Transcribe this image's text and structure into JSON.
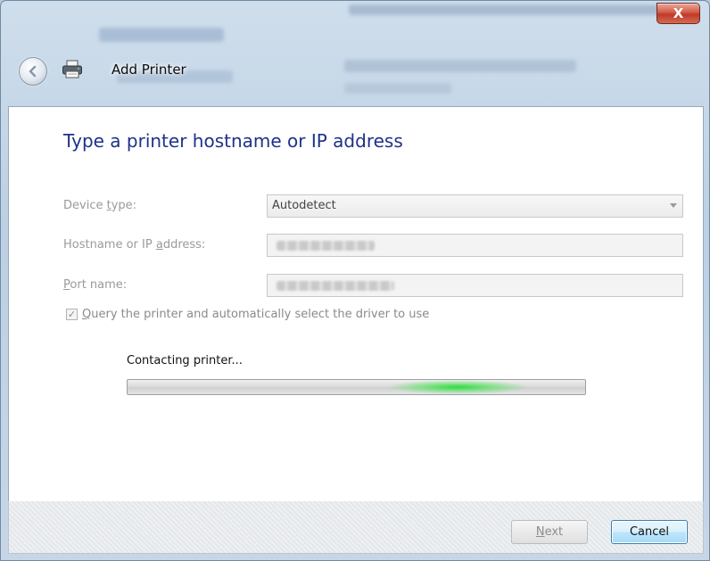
{
  "window": {
    "title": "Add Printer",
    "close_glyph": "X",
    "back_icon": "back-arrow-icon",
    "app_icon": "printer-icon"
  },
  "wizard": {
    "heading": "Type a printer hostname or IP address",
    "device_type": {
      "label_pre": "Device ",
      "label_key": "t",
      "label_post": "ype:",
      "value": "Autodetect"
    },
    "hostname": {
      "label_pre": "Hostname or IP ",
      "label_key": "a",
      "label_post": "ddress:"
    },
    "port": {
      "label_key": "P",
      "label_post": "ort name:"
    },
    "query_checkbox": {
      "checked": true,
      "label_key": "Q",
      "label_post": "uery the printer and automatically select the driver to use"
    },
    "status": "Contacting printer...",
    "progress": {
      "state": "indeterminate"
    }
  },
  "footer": {
    "next_label": "Next",
    "cancel_label": "Cancel"
  },
  "colors": {
    "heading": "#1e3287",
    "progress_glow": "#28dc3c",
    "cancel_border": "#3c7fb1"
  }
}
